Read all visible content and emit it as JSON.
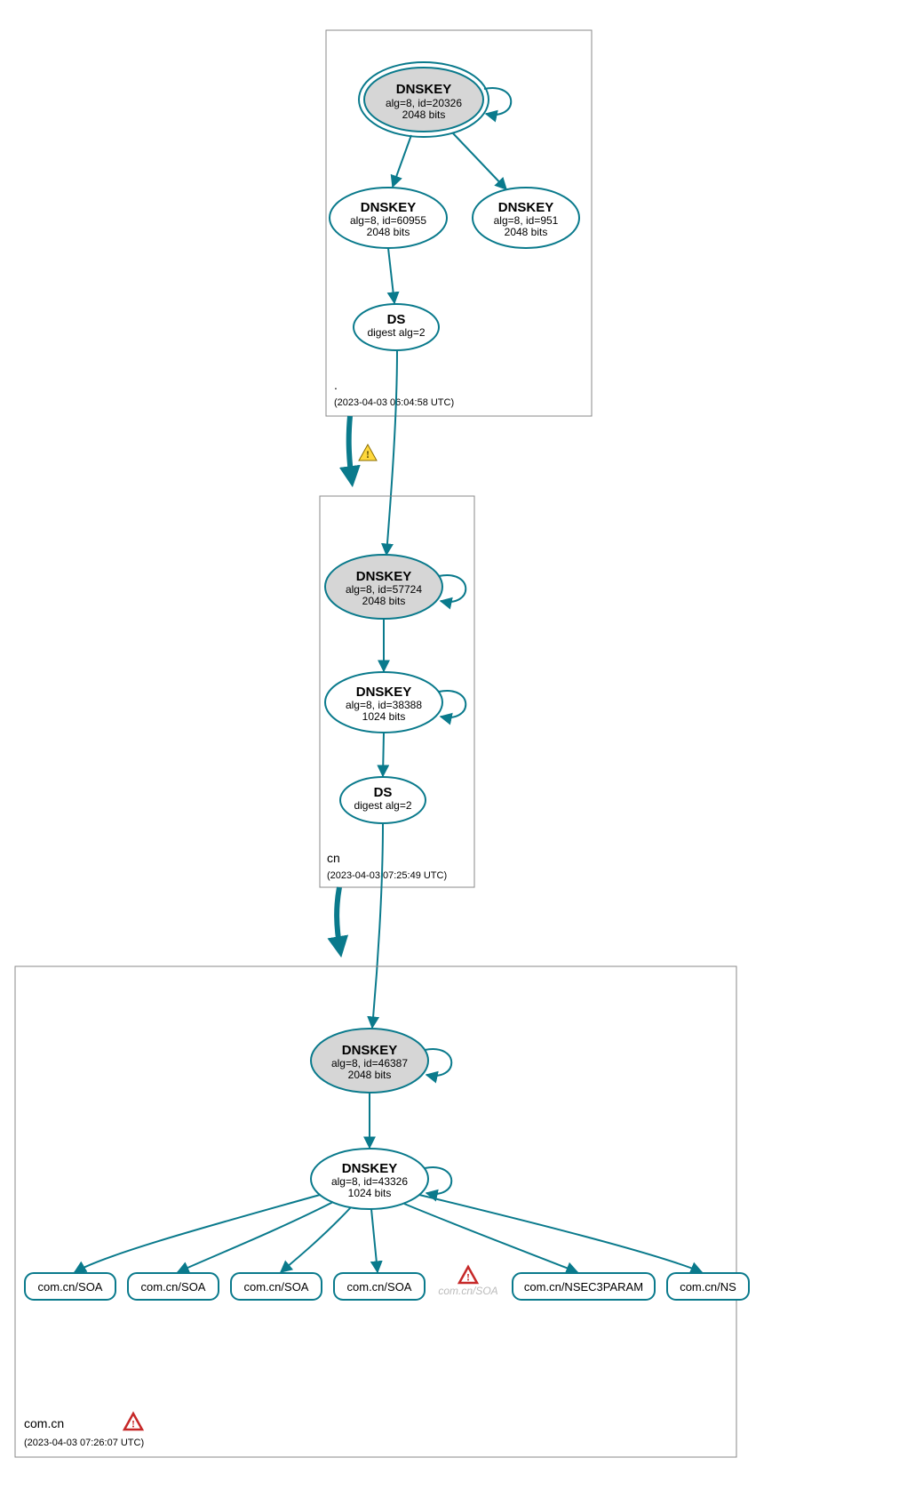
{
  "zones": {
    "root": {
      "name": ".",
      "timestamp": "(2023-04-03 06:04:58 UTC)"
    },
    "cn": {
      "name": "cn",
      "timestamp": "(2023-04-03 07:25:49 UTC)"
    },
    "comcn": {
      "name": "com.cn",
      "timestamp": "(2023-04-03 07:26:07 UTC)"
    }
  },
  "nodes": {
    "root_ksk": {
      "title": "DNSKEY",
      "l1": "alg=8, id=20326",
      "l2": "2048 bits"
    },
    "root_zsk": {
      "title": "DNSKEY",
      "l1": "alg=8, id=60955",
      "l2": "2048 bits"
    },
    "root_zsk2": {
      "title": "DNSKEY",
      "l1": "alg=8, id=951",
      "l2": "2048 bits"
    },
    "root_ds": {
      "title": "DS",
      "l1": "digest alg=2",
      "l2": ""
    },
    "cn_ksk": {
      "title": "DNSKEY",
      "l1": "alg=8, id=57724",
      "l2": "2048 bits"
    },
    "cn_zsk": {
      "title": "DNSKEY",
      "l1": "alg=8, id=38388",
      "l2": "1024 bits"
    },
    "cn_ds": {
      "title": "DS",
      "l1": "digest alg=2",
      "l2": ""
    },
    "comcn_ksk": {
      "title": "DNSKEY",
      "l1": "alg=8, id=46387",
      "l2": "2048 bits"
    },
    "comcn_zsk": {
      "title": "DNSKEY",
      "l1": "alg=8, id=43326",
      "l2": "1024 bits"
    }
  },
  "records": {
    "r1": "com.cn/SOA",
    "r2": "com.cn/SOA",
    "r3": "com.cn/SOA",
    "r4": "com.cn/SOA",
    "r5_faded": "com.cn/SOA",
    "r6": "com.cn/NSEC3PARAM",
    "r7": "com.cn/NS"
  },
  "colors": {
    "accent": "#0a7a8c",
    "ksk_fill": "#d6d6d6",
    "warn_yellow": "#ffd83d",
    "warn_red": "#c62828"
  }
}
